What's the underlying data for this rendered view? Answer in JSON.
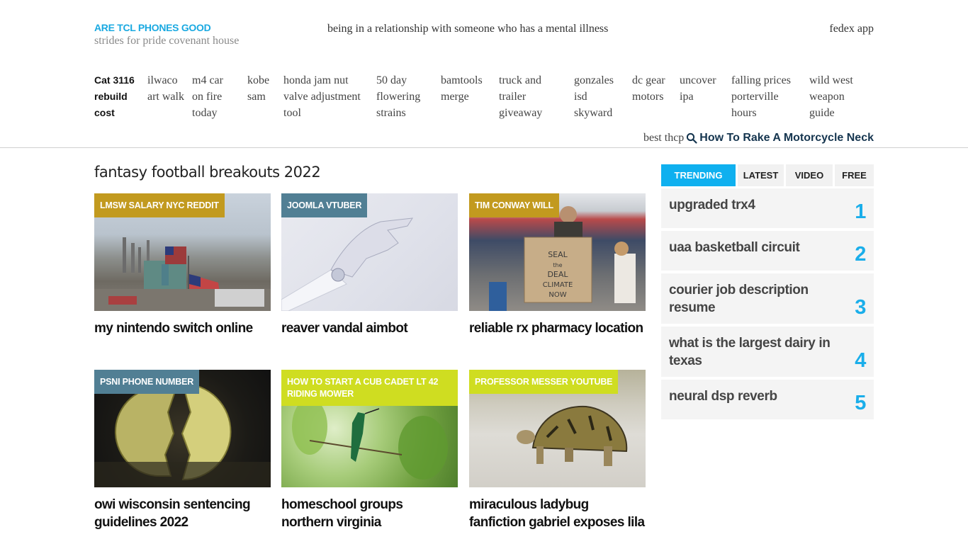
{
  "header": {
    "site_title": "ARE TCL PHONES GOOD",
    "tagline": "strides for pride covenant house",
    "center_link": "being in a relationship with someone who has a mental illness",
    "right_link": "fedex app"
  },
  "nav": {
    "items": [
      {
        "label": "Cat 3116 rebuild cost"
      },
      {
        "label": "ilwaco art walk"
      },
      {
        "label": "m4 car on fire today"
      },
      {
        "label": "kobe sam"
      },
      {
        "label": "honda jam nut valve adjustment tool"
      },
      {
        "label": "50 day flowering strains"
      },
      {
        "label": "bamtools merge"
      },
      {
        "label": "truck and trailer giveaway"
      },
      {
        "label": "gonzales isd skyward"
      },
      {
        "label": "dc gear motors"
      },
      {
        "label": "uncover ipa"
      },
      {
        "label": "falling prices porterville hours"
      },
      {
        "label": "wild west weapon guide"
      }
    ]
  },
  "search": {
    "prefix": "best thcp",
    "icon": "search-icon",
    "title": "How To Rake A Motorcycle Neck"
  },
  "main": {
    "section_title": "fantasy football breakouts 2022",
    "cards": [
      {
        "tag": "LMSW SALARY NYC REDDIT",
        "tag_color": "#c29a1f",
        "title": "my nintendo switch online",
        "image": "refinery with american flags"
      },
      {
        "tag": "JOOMLA VTUBER",
        "tag_color": "#517f94",
        "title": "reaver vandal aimbot",
        "image": "robotic hand"
      },
      {
        "tag": "TIM CONWAY WILL",
        "tag_color": "#c29a1f",
        "title": "reliable rx pharmacy location",
        "image": "climate protest sign"
      },
      {
        "tag": "PSNI PHONE NUMBER",
        "tag_color": "#517f94",
        "title": "owi wisconsin sentencing guidelines 2022",
        "image": "broken bitcoin"
      },
      {
        "tag": "HOW TO START A CUB CADET LT 42 RIDING MOWER",
        "tag_color": "#cfdd21",
        "title": "homeschool groups northern virginia",
        "image": "hummingbird in leaves"
      },
      {
        "tag": "PROFESSOR MESSER YOUTUBE",
        "tag_color": "#cfdd21",
        "title": "miraculous ladybug fanfiction gabriel exposes lila",
        "image": "tortoise walking"
      }
    ]
  },
  "sidebar": {
    "tabs": [
      {
        "label": "TRENDING",
        "active": true
      },
      {
        "label": "LATEST",
        "active": false
      },
      {
        "label": "VIDEO",
        "active": false
      },
      {
        "label": "FREE",
        "active": false
      }
    ],
    "trending": [
      {
        "title": "upgraded trx4",
        "rank": "1"
      },
      {
        "title": "uaa basketball circuit",
        "rank": "2"
      },
      {
        "title": "courier job description resume",
        "rank": "3"
      },
      {
        "title": "what is the largest dairy in texas",
        "rank": "4"
      },
      {
        "title": "neural dsp reverb",
        "rank": "5"
      }
    ]
  },
  "colors": {
    "accent": "#1aa9e1",
    "tab_active": "#0fb0ef",
    "tag_gold": "#c29a1f",
    "tag_slate": "#517f94",
    "tag_lime": "#cfdd21"
  }
}
